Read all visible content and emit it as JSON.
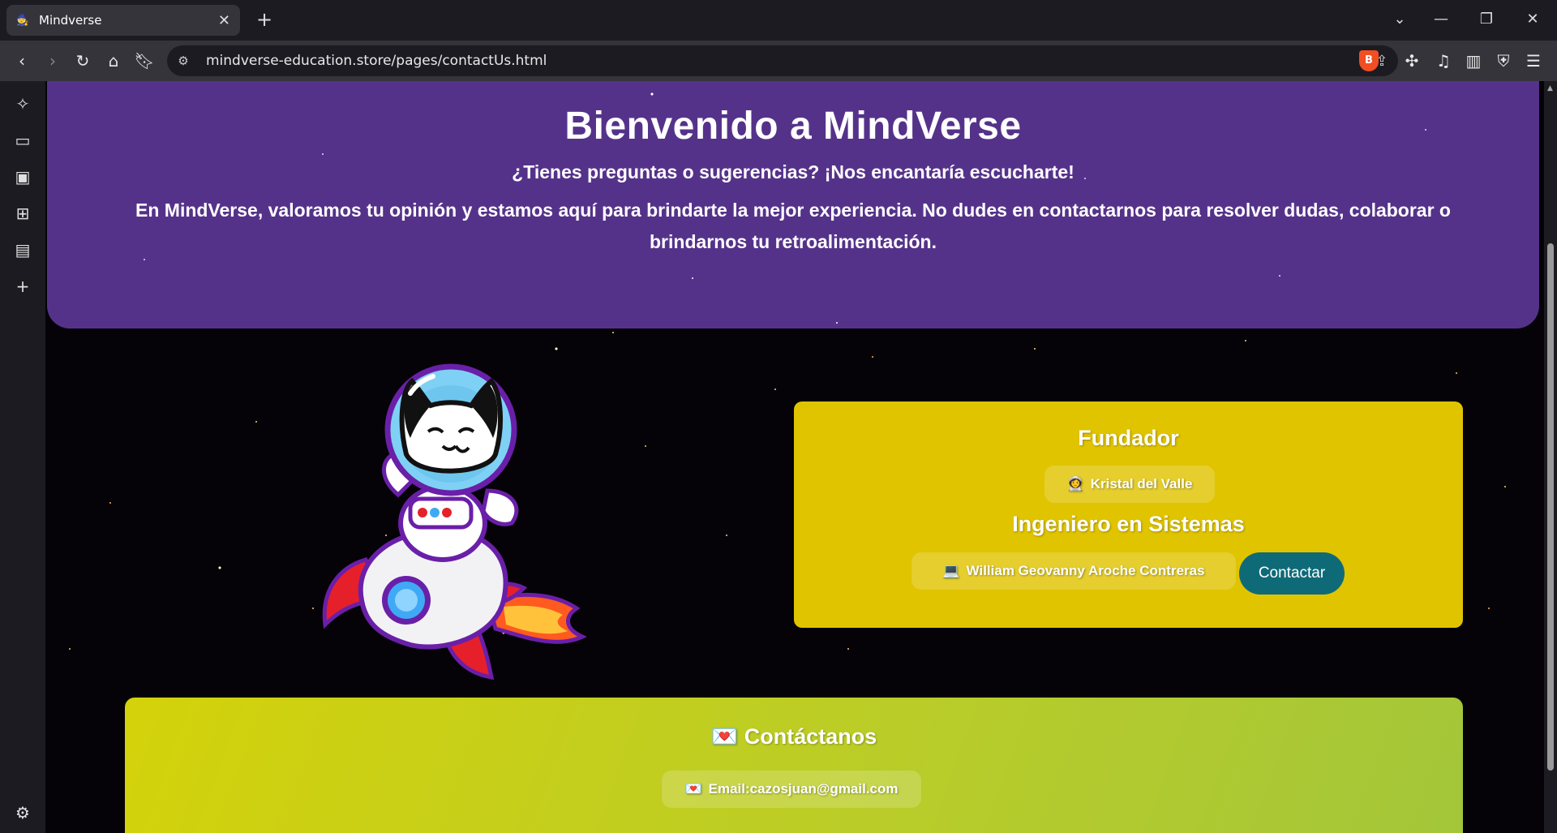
{
  "browser": {
    "tab_title": "Mindverse",
    "tab_close": "✕",
    "new_tab": "+",
    "url": "mindverse-education.store/pages/contactUs.html",
    "window_controls": {
      "tab_search": "⌄",
      "minimize": "—",
      "restore": "❐",
      "close": "✕"
    }
  },
  "hero": {
    "title": "Bienvenido a MindVerse",
    "subtitle": "¿Tienes preguntas o sugerencias? ¡Nos encantaría escucharte!",
    "desc_prefix": "En ",
    "desc_brand": "MindVerse",
    "desc_rest": ", valoramos tu opinión y estamos aquí para brindarte la mejor experiencia. No dudes en contactarnos para resolver dudas, colaborar o brindarnos tu retroalimentación."
  },
  "team": {
    "founder_heading": "Fundador",
    "founder_emoji": "👩‍🚀",
    "founder_name": "Kristal del Valle",
    "engineer_heading": "Ingeniero en Sistemas",
    "engineer_emoji": "💻",
    "engineer_name": "William Geovanny Aroche Contreras",
    "contact_button": "Contactar"
  },
  "contact": {
    "heading_emoji": "💌",
    "heading": "Contáctanos",
    "email_emoji": "💌",
    "email_text": "Email:cazosjuan@gmail.com"
  },
  "colors": {
    "hero_bg": "#55328a",
    "team_card_bg": "#e0c400",
    "contact_button_bg": "#0f6a78",
    "contact_card_bg": "#c4d020"
  }
}
